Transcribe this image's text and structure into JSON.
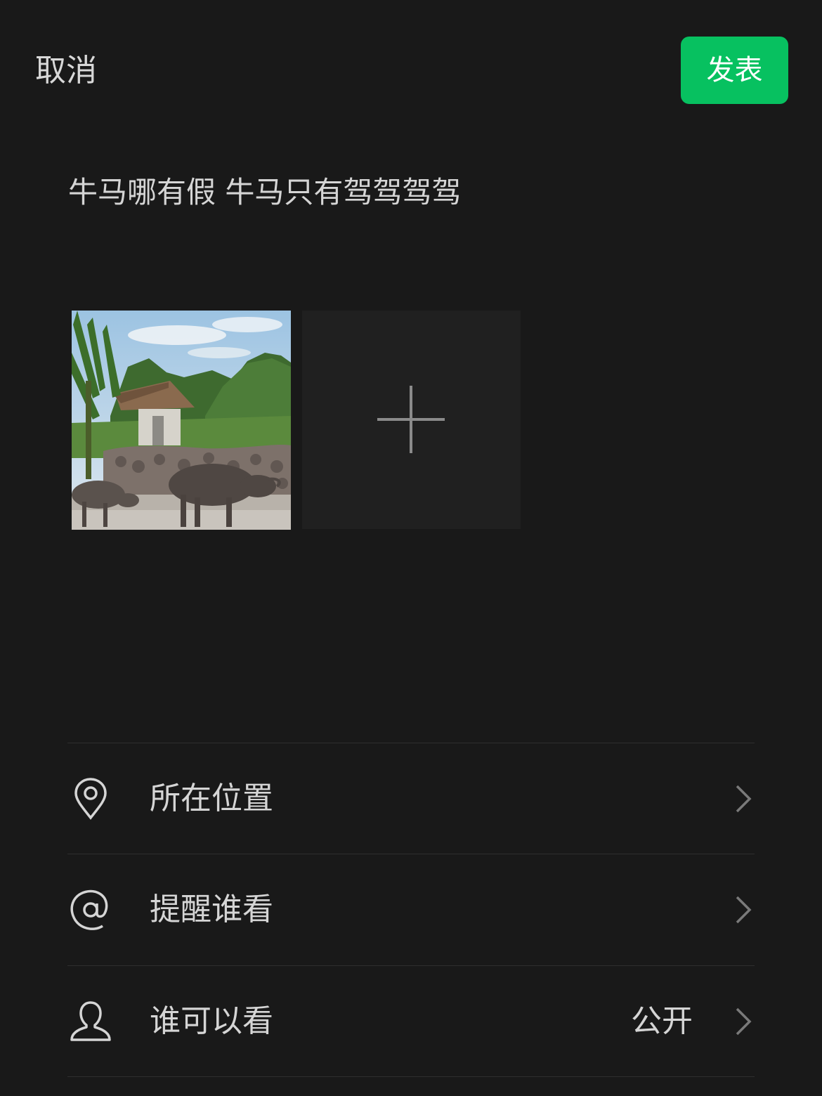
{
  "header": {
    "cancel_label": "取消",
    "publish_label": "发表"
  },
  "composer": {
    "text": "牛马哪有假 牛马只有驾驾驾驾"
  },
  "media": {
    "photo_icon": "photo-thumbnail",
    "add_icon": "plus-icon"
  },
  "options": {
    "location": {
      "label": "所在位置",
      "icon": "location-pin-icon"
    },
    "mention": {
      "label": "提醒谁看",
      "icon": "at-icon"
    },
    "visibility": {
      "label": "谁可以看",
      "value": "公开",
      "icon": "person-icon"
    }
  },
  "colors": {
    "background": "#191919",
    "accent": "#07c160",
    "tile": "#202020",
    "divider": "#2e2e2e"
  }
}
